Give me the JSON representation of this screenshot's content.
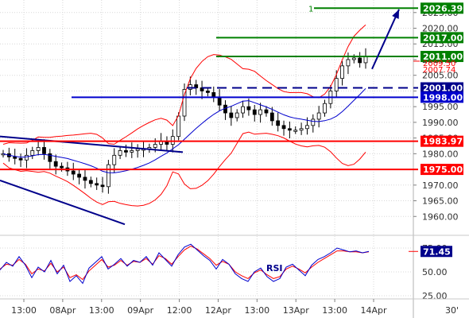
{
  "chart_data": [
    {
      "type": "candlestick",
      "title": "",
      "price_axis": {
        "ylim": [
          1955,
          2029
        ],
        "ticks": [
          1960,
          1965,
          1970,
          1975,
          1980,
          1985,
          1990,
          1995,
          2000,
          2005,
          2010,
          2015,
          2020,
          2025
        ],
        "tick_labels": [
          "1960.00",
          "1965.00",
          "1970.00",
          "1975.00",
          "1980.00",
          "1985.00",
          "1990.00",
          "1995.00",
          "2000.00",
          "2005.00",
          "2010.00",
          "2015.00",
          "2020.00",
          "2025.00"
        ]
      },
      "x_axis": {
        "tick_labels": [
          "13:00",
          "08Apr",
          "13:00",
          "09Apr",
          "12:00",
          "12Apr",
          "13:00",
          "13Apr",
          "13:00",
          "14Apr"
        ],
        "timeframe_label": "30'"
      },
      "grid": true,
      "series": [
        {
          "name": "",
          "style": "candlestick",
          "values": [
            1980.0,
            1979.0,
            1978.5,
            1978.0,
            1979.5,
            1981.0,
            1982.0,
            1980.0,
            1977.5,
            1976.0,
            1975.5,
            1974.5,
            1973.5,
            1972.5,
            1971.5,
            1970.5,
            1970.0,
            1969.5,
            1976.5,
            1979.5,
            1981.0,
            1980.5,
            1981.0,
            1981.5,
            1981.5,
            1982.0,
            1983.0,
            1984.0,
            1983.0,
            1985.5,
            1992.0,
            2000.5,
            2002.0,
            2001.0,
            2000.0,
            1999.5,
            1998.0,
            1995.5,
            1993.0,
            1991.5,
            1993.0,
            1995.0,
            1994.0,
            1992.5,
            1994.0,
            1993.0,
            1990.5,
            1989.0,
            1988.0,
            1987.5,
            1987.5,
            1988.0,
            1989.0,
            1991.0,
            1993.0,
            1996.0,
            2000.0,
            2004.0,
            2008.0,
            2010.0,
            2010.5,
            2009.0,
            2011.0
          ]
        }
      ],
      "horizontal_levels": [
        {
          "value": 2026.39,
          "label": "2026.39",
          "color": "#008000",
          "style": "solid"
        },
        {
          "value": 2017.0,
          "label": "2017.00",
          "color": "#008000",
          "style": "solid"
        },
        {
          "value": 2011.0,
          "label": "2011.00",
          "color": "#008000",
          "style": "solid"
        },
        {
          "value": 2001.0,
          "label": "2001.00",
          "color": "#00008b",
          "style": "dashed"
        },
        {
          "value": 1998.0,
          "label": "1998.00",
          "color": "#0000cd",
          "style": "solid"
        },
        {
          "value": 1983.97,
          "label": "1983.97",
          "color": "#ff0000",
          "style": "solid"
        },
        {
          "value": 1975.0,
          "label": "1975.00",
          "color": "#ff0000",
          "style": "solid"
        }
      ],
      "level_markers": [
        {
          "text": "1",
          "color": "#008000"
        }
      ],
      "current_price_labels": [
        "2009.50",
        "2007.74"
      ],
      "trendlines": [
        {
          "from_value": 1985.5,
          "to_value": 1980.5,
          "color": "#00008b"
        },
        {
          "from_value": 1971.5,
          "to_value": 1957.5,
          "color": "#00008b"
        }
      ],
      "projection_arrow": {
        "from_value": 2007.0,
        "to_value": 2026.0,
        "color": "#00008b"
      },
      "overlays": [
        "bollinger-bands",
        "moving-average"
      ],
      "colors": {
        "bollinger": "#ff0000",
        "moving_average": "#0000cd",
        "candle": "#000000"
      }
    },
    {
      "type": "line",
      "title": "",
      "annotation": "RSI",
      "ylim": [
        25,
        85
      ],
      "ticks": [
        25,
        50,
        75
      ],
      "tick_labels": [
        "25.00",
        "50.00",
        "75.00"
      ],
      "current_value_label": "71.45",
      "series": [
        {
          "name": "",
          "color": "#0000cd",
          "values": [
            52,
            60,
            56,
            66,
            57,
            44,
            55,
            50,
            62,
            48,
            57,
            40,
            46,
            38,
            54,
            60,
            66,
            53,
            58,
            64,
            56,
            62,
            60,
            66,
            57,
            70,
            63,
            56,
            68,
            76,
            79,
            73,
            67,
            62,
            53,
            63,
            58,
            48,
            43,
            40,
            50,
            54,
            45,
            40,
            43,
            55,
            58,
            52,
            46,
            57,
            63,
            66,
            70,
            75,
            73,
            71,
            72,
            70,
            71.45
          ]
        },
        {
          "name": "",
          "color": "#ff0000",
          "values": [
            53,
            58,
            57,
            63,
            58,
            48,
            53,
            51,
            59,
            50,
            55,
            44,
            47,
            42,
            51,
            57,
            63,
            55,
            57,
            62,
            57,
            61,
            60,
            64,
            58,
            67,
            64,
            58,
            66,
            73,
            77,
            74,
            69,
            64,
            57,
            61,
            58,
            50,
            46,
            43,
            49,
            52,
            47,
            43,
            45,
            53,
            56,
            53,
            49,
            55,
            60,
            64,
            68,
            72,
            72,
            71,
            71,
            70,
            71
          ]
        }
      ]
    }
  ]
}
